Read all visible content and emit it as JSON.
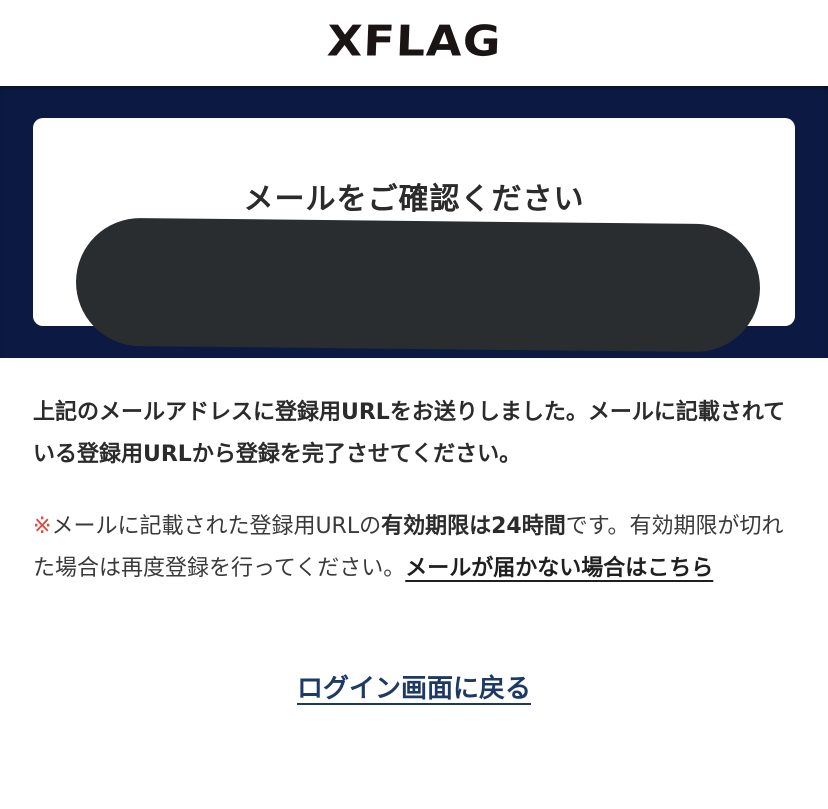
{
  "header": {
    "logo": "XFLAG"
  },
  "card": {
    "title": "メールをご確認ください"
  },
  "message": {
    "line1": "上記のメールアドレスに登録用URLをお送りしました。メールに記載されている登録用URLから登録を完了させてください。"
  },
  "notice": {
    "mark": "※",
    "text_a": "メールに記載された登録用URLの",
    "emphasis": "有効期限は24時間",
    "text_b": "です。有効期限が切れた場合は再度登録を行ってください。",
    "link": "メールが届かない場合はこちら"
  },
  "back_link": "ログイン画面に戻る",
  "colors": {
    "hero": "#0c1a43",
    "link": "#1d3a66",
    "mark": "#e0453b"
  }
}
